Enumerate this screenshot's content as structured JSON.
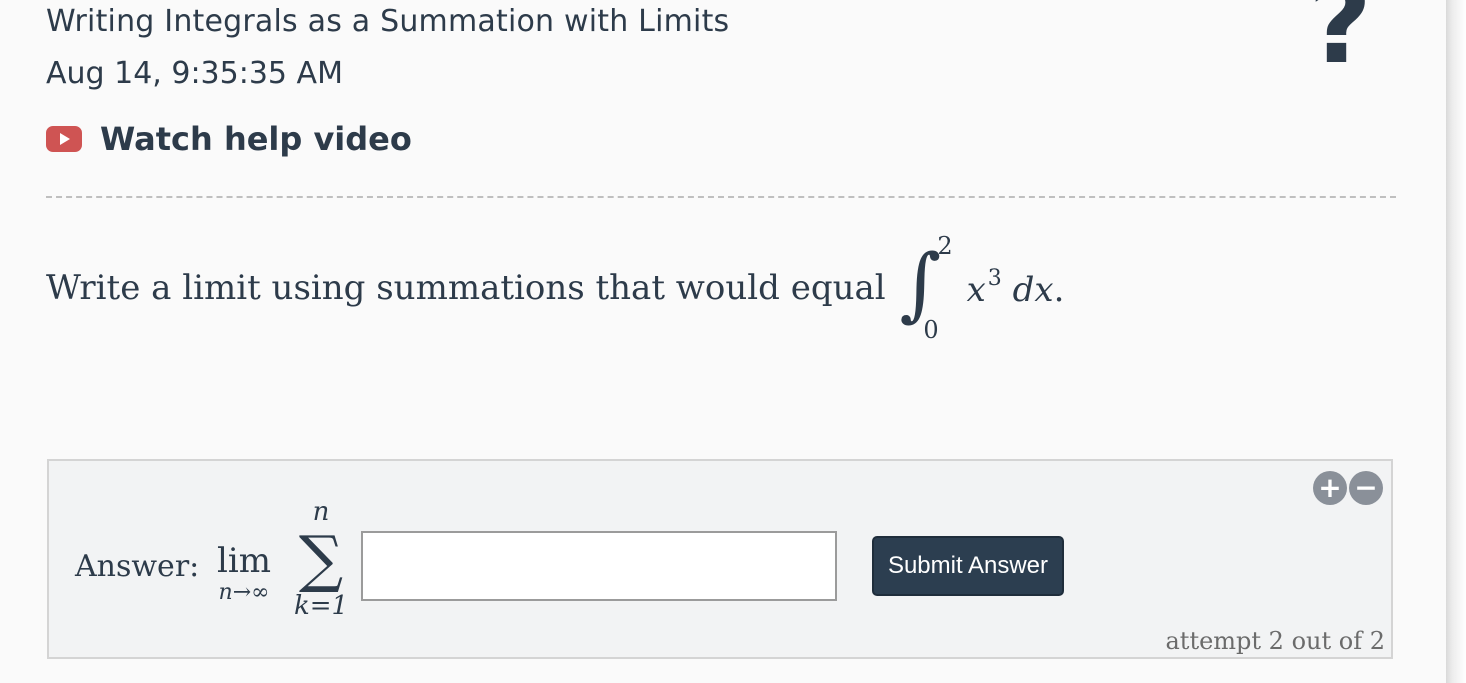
{
  "header": {
    "title": "Writing Integrals as a Summation with Limits",
    "timestamp": "Aug 14, 9:35:35 AM",
    "help_icon_glyph": "?"
  },
  "help_video": {
    "label": "Watch help video",
    "icon": "youtube-play-icon",
    "icon_color": "#cf5453"
  },
  "question": {
    "prompt": "Write a limit using summations that would equal",
    "integral_sign": "∫",
    "upper_bound": "2",
    "lower_bound": "0",
    "integrand_base": "x",
    "integrand_exponent": "3",
    "differential": "dx",
    "end_punct": "."
  },
  "answer": {
    "label": "Answer:",
    "lim_word": "lim",
    "lim_sub": "n→∞",
    "sigma_sign": "∑",
    "sigma_upper": "n",
    "sigma_lower": "k=1",
    "input_value": "",
    "submit_label": "Submit Answer",
    "attempt_text": "attempt 2 out of 2",
    "zoom_in_glyph": "+",
    "zoom_out_glyph": "−"
  },
  "colors": {
    "text": "#2d3b4a",
    "submit_bg": "#2c3e50",
    "answer_bg": "#f2f3f4"
  }
}
